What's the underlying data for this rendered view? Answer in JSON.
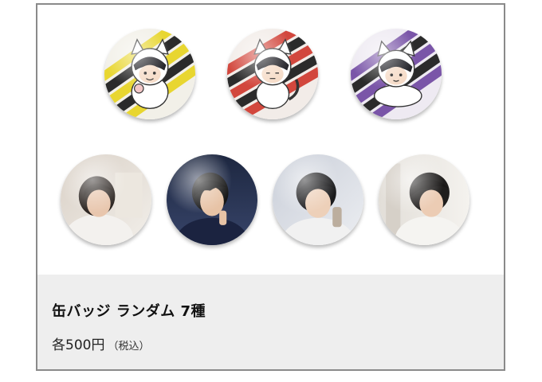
{
  "product": {
    "title": "缶バッジ ランダム 7種",
    "price": "各500円",
    "tax_note": "（税込）"
  },
  "badges": [
    {
      "kind": "illustration",
      "color": "#e8d630",
      "stripe_text": "dis-communicate"
    },
    {
      "kind": "illustration",
      "color": "#d2473d",
      "stripe_text": "dis-communicate"
    },
    {
      "kind": "illustration",
      "color": "#7a55a8",
      "stripe_text": "dis-communicate"
    },
    {
      "kind": "photo",
      "color": "#e6e1dc"
    },
    {
      "kind": "photo",
      "color": "#27304a"
    },
    {
      "kind": "photo",
      "color": "#d8dbe2"
    },
    {
      "kind": "photo",
      "color": "#eae8e4"
    }
  ]
}
